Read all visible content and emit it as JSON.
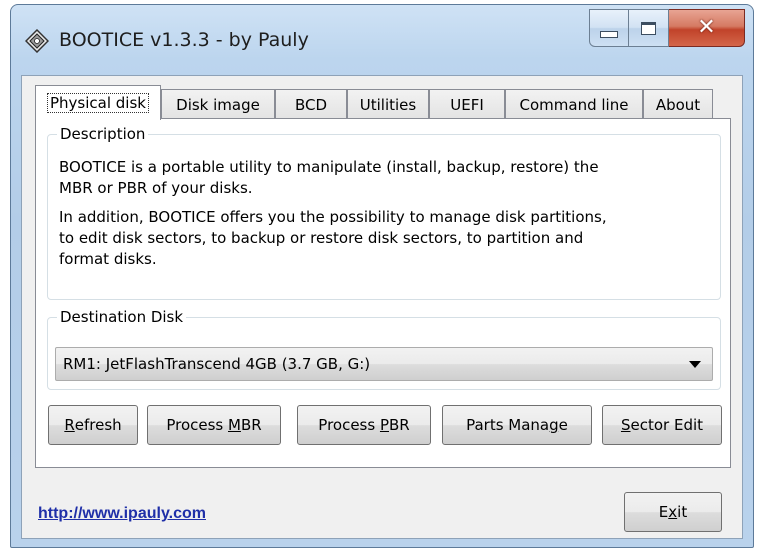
{
  "window": {
    "title": "BOOTICE v1.3.3 - by Pauly",
    "icon": "disk-diamond-icon",
    "caption_buttons": [
      "minimize-icon",
      "maximize-icon",
      "close-icon"
    ]
  },
  "tabs": [
    {
      "label": "Physical disk",
      "active": true
    },
    {
      "label": "Disk image",
      "active": false
    },
    {
      "label": "BCD",
      "active": false
    },
    {
      "label": "Utilities",
      "active": false
    },
    {
      "label": "UEFI",
      "active": false
    },
    {
      "label": "Command line",
      "active": false
    },
    {
      "label": "About",
      "active": false
    }
  ],
  "description": {
    "legend": "Description",
    "para1_line1": "BOOTICE is a portable utility to manipulate (install, backup, restore) the",
    "para1_line2": "MBR or PBR of your disks.",
    "para2_line1": "In addition, BOOTICE offers you the possibility to manage disk partitions,",
    "para2_line2": "to edit disk sectors, to backup or restore disk sectors, to partition and",
    "para2_line3": "format disks."
  },
  "destination": {
    "legend": "Destination Disk",
    "selected": "RM1: JetFlashTranscend 4GB (3.7 GB, G:)"
  },
  "buttons": {
    "refresh_pre": "",
    "refresh_key": "R",
    "refresh_post": "efresh",
    "mbr_pre": "Process ",
    "mbr_key": "M",
    "mbr_post": "BR",
    "pbr_pre": "Process ",
    "pbr_key": "P",
    "pbr_post": "BR",
    "parts_pre": "Parts Mana",
    "parts_key": "g",
    "parts_post": "e",
    "sector_pre": "",
    "sector_key": "S",
    "sector_post": "ector Edit",
    "exit_pre": "E",
    "exit_key": "x",
    "exit_post": "it"
  },
  "footer": {
    "link": "http://www.ipauly.com"
  },
  "colors": {
    "link": "#1f2fa8",
    "close_button": "#c1432a"
  }
}
